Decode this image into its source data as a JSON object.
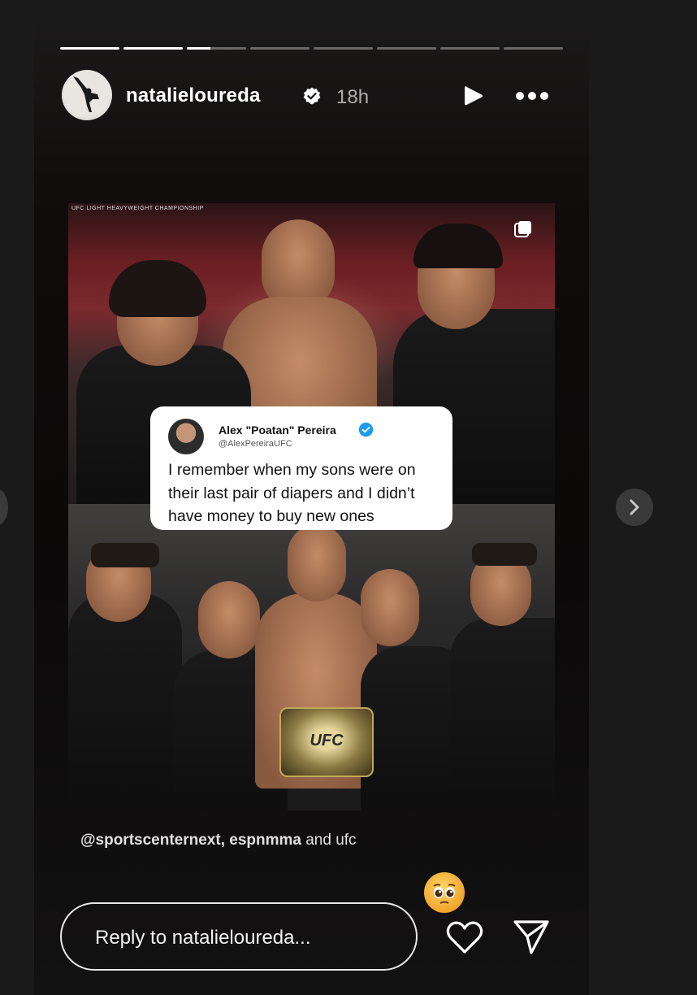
{
  "story": {
    "segments_total": 8,
    "current_segment": 3,
    "current_segment_progress": 0.4,
    "author": {
      "username": "natalieloureda",
      "verified": true,
      "time_ago": "18h"
    },
    "controls": {
      "play_icon": "play-icon",
      "more_icon": "more-horizontal-icon"
    },
    "post": {
      "headline_top": "UFC LIGHT HEAVYWEIGHT CHAMPIONSHIP",
      "belt_text": "UFC",
      "tweet": {
        "name": "Alex \"Poatan\" Pereira",
        "handle": "@AlexPereiraUFC",
        "text": "I remember when my sons were on their last pair of diapers and I didn’t have money to buy new ones"
      }
    },
    "caption": {
      "primary": "@sportscenternext, espnmma",
      "rest": " and ufc"
    },
    "reaction_emoji": "pleading-face-emoji",
    "reply": {
      "placeholder": "Reply to natalieloureda..."
    }
  },
  "colors": {
    "background": "#1a1a1a",
    "verified_blue": "#1d9bf0",
    "progress_active": "#ffffff"
  }
}
